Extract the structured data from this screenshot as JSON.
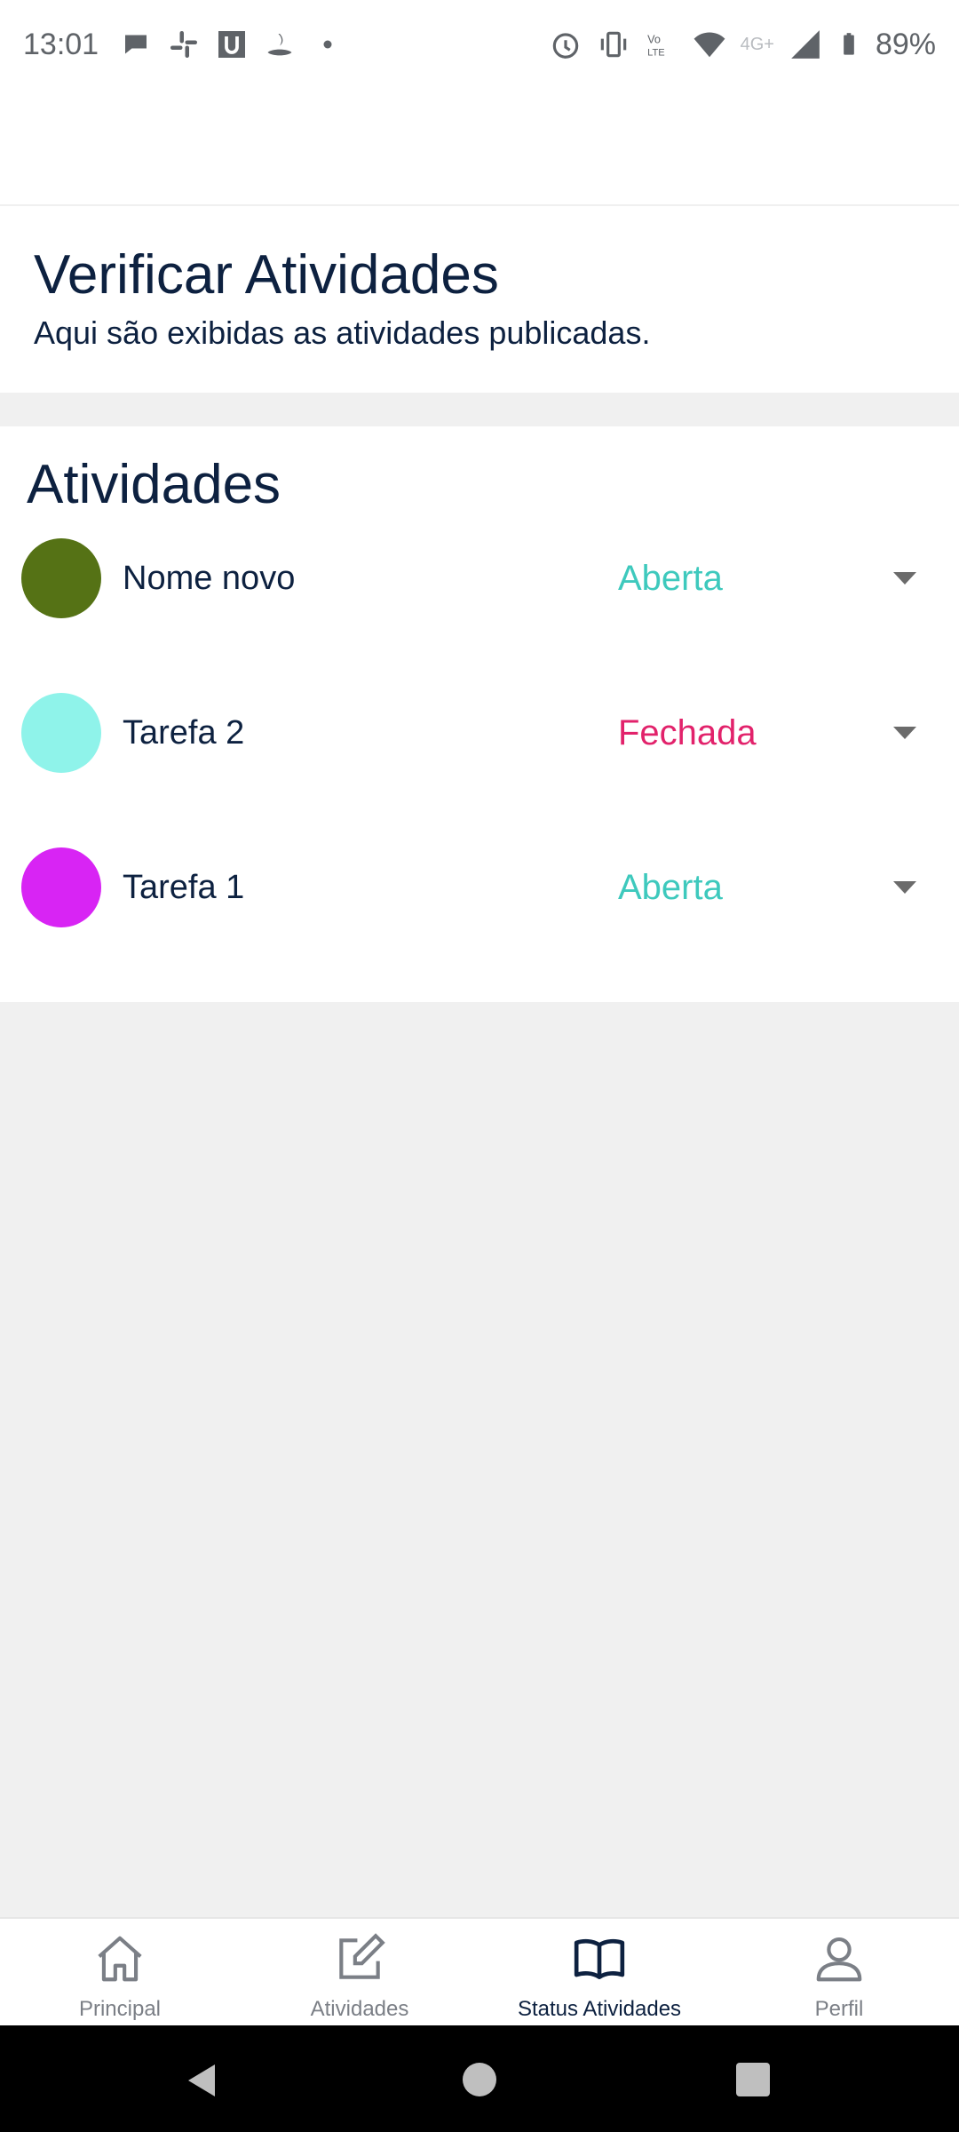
{
  "status_bar": {
    "time": "13:01",
    "battery": "89%",
    "network_label": "4G+",
    "notification_icons": [
      "chat-bubble-icon",
      "slack-icon",
      "u-app-icon",
      "santander-icon",
      "dot-icon"
    ],
    "system_icons": [
      "alarm-icon",
      "vibrate-icon",
      "volte-icon",
      "wifi-icon",
      "cell-signal-icon",
      "battery-icon"
    ]
  },
  "header": {
    "title": "Verificar Atividades",
    "subtitle": "Aqui são exibidas as atividades publicadas."
  },
  "activities": {
    "section_title": "Atividades",
    "items": [
      {
        "name": "Nome novo",
        "status": "Aberta",
        "color": "#557215",
        "status_color": "#3ec9bd"
      },
      {
        "name": "Tarefa 2",
        "status": "Fechada",
        "color": "#8ff3ea",
        "status_color": "#e2226b"
      },
      {
        "name": "Tarefa 1",
        "status": "Aberta",
        "color": "#d824f4",
        "status_color": "#3ec9bd"
      }
    ]
  },
  "bottom_nav": {
    "items": [
      {
        "label": "Principal",
        "icon": "home-icon",
        "active": false
      },
      {
        "label": "Atividades",
        "icon": "edit-icon",
        "active": false
      },
      {
        "label": "Status Atividades",
        "icon": "book-icon",
        "active": true
      },
      {
        "label": "Perfil",
        "icon": "person-icon",
        "active": false
      }
    ]
  },
  "colors": {
    "primary_text": "#0d2140",
    "inactive_nav": "#7b7f86",
    "background": "#f0f0f0"
  }
}
